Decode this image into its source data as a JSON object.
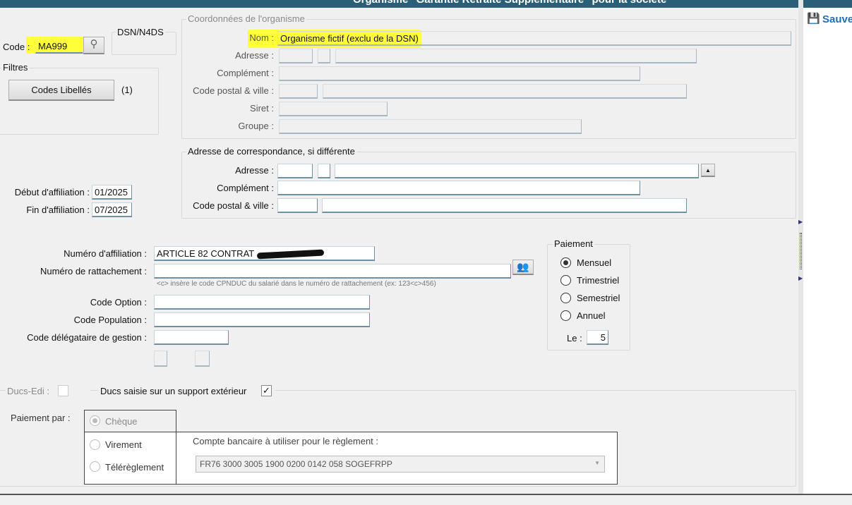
{
  "window": {
    "title": "Organisme \"Garantie Retraite Supplémentaire\" pour la société"
  },
  "header": {
    "code_label": "Code :",
    "code_value": "MA999",
    "search_icon": "search-icon",
    "dsn_label": "DSN/N4DS"
  },
  "filters": {
    "legend": "Filtres",
    "button_label": "Codes Libellés",
    "count": "(1)"
  },
  "organisme": {
    "legend": "Coordonnées de l'organisme",
    "nom_label": "Nom :",
    "nom_value": "Organisme fictif (exclu de la DSN)",
    "adresse_label": "Adresse :",
    "complement_label": "Complément :",
    "cp_label": "Code postal & ville :",
    "siret_label": "Siret :",
    "groupe_label": "Groupe :"
  },
  "correspondance": {
    "legend": "Adresse de correspondance, si différente",
    "adresse_label": "Adresse :",
    "complement_label": "Complément :",
    "cp_label": "Code postal & ville :"
  },
  "affiliation": {
    "debut_label": "Début d'affiliation :",
    "debut_value": "01/2025",
    "fin_label": "Fin d'affiliation :",
    "fin_value": "07/2025"
  },
  "contrat": {
    "numero_affiliation_label": "Numéro d'affiliation :",
    "numero_affiliation_value": "ARTICLE 82 CONTRAT",
    "rattachement_label": "Numéro de rattachement :",
    "rattachement_hint": "<c> insère le code CPNDUC du salarié dans le numéro de rattachement (ex: 123<c>456)",
    "code_option_label": "Code Option :",
    "code_population_label": "Code Population :",
    "code_delegataire_label": "Code délégataire de gestion :"
  },
  "paiement": {
    "legend": "Paiement",
    "options": [
      "Mensuel",
      "Trimestriel",
      "Semestriel",
      "Annuel"
    ],
    "selected": "Mensuel",
    "le_label": "Le :",
    "le_value": "5"
  },
  "ducs": {
    "edi_label": "Ducs-Edi :",
    "edi_checked": false,
    "support_label": "Ducs saisie sur un support extérieur",
    "support_checked": true,
    "paiement_par_label": "Paiement par :",
    "methods": [
      "Chèque",
      "Virement",
      "Télérèglement"
    ],
    "selected": "Chèque",
    "compte_label": "Compte bancaire à utiliser pour le règlement :",
    "compte_value": "FR76 3000 3005 1900 0200 0142 058  SOGEFRPP"
  },
  "toolbar": {
    "save_label": "Sauver",
    "save_color": "#1f6fb5"
  },
  "colors": {
    "titlebar": "#2b5f78",
    "highlight": "#ffff3a"
  }
}
